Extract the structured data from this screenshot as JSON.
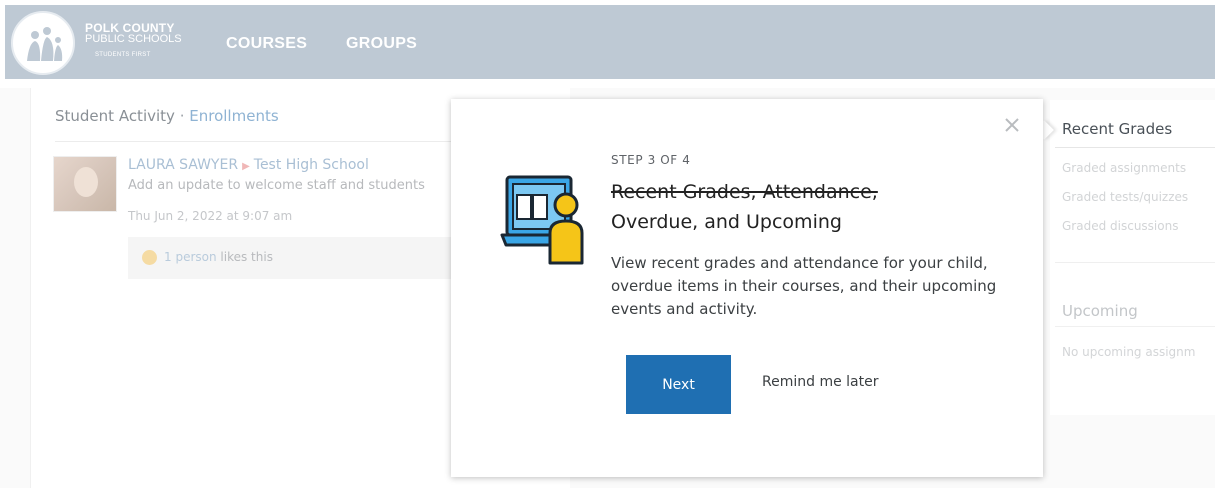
{
  "header": {
    "logo": {
      "line1": "POLK COUNTY",
      "line2": "PUBLIC SCHOOLS",
      "tagline": "STUDENTS FIRST"
    },
    "nav": [
      {
        "label": "COURSES"
      },
      {
        "label": "GROUPS"
      }
    ]
  },
  "activity": {
    "title": "Student Activity",
    "separator": "·",
    "enrollments_link": "Enrollments",
    "post": {
      "user": "LAURA SAWYER",
      "school": "Test High School",
      "body": "Add an update to welcome staff and students",
      "date": "Thu Jun 2, 2022 at 9:07 am",
      "likes_count": "1 person",
      "likes_suffix": "likes this"
    }
  },
  "sidebar": {
    "recent_grades_title": "Recent Grades",
    "links": [
      "Graded assignments",
      "Graded tests/quizzes",
      "Graded discussions"
    ],
    "upcoming_title": "Upcoming",
    "upcoming_empty": "No upcoming assignm"
  },
  "tour": {
    "step": "STEP 3 OF 4",
    "title_old": "Recent Grades, Attendance,",
    "title": "Overdue, and Upcoming",
    "description": "View recent grades and attendance for your child, overdue items in their courses, and their upcoming events and activity.",
    "next_label": "Next",
    "later_label": "Remind me later"
  },
  "colors": {
    "header_bg": "#bec9d4",
    "primary_button": "#1f6fb2",
    "illustration_blue": "#3aa6e6",
    "illustration_yellow": "#f5c518"
  }
}
